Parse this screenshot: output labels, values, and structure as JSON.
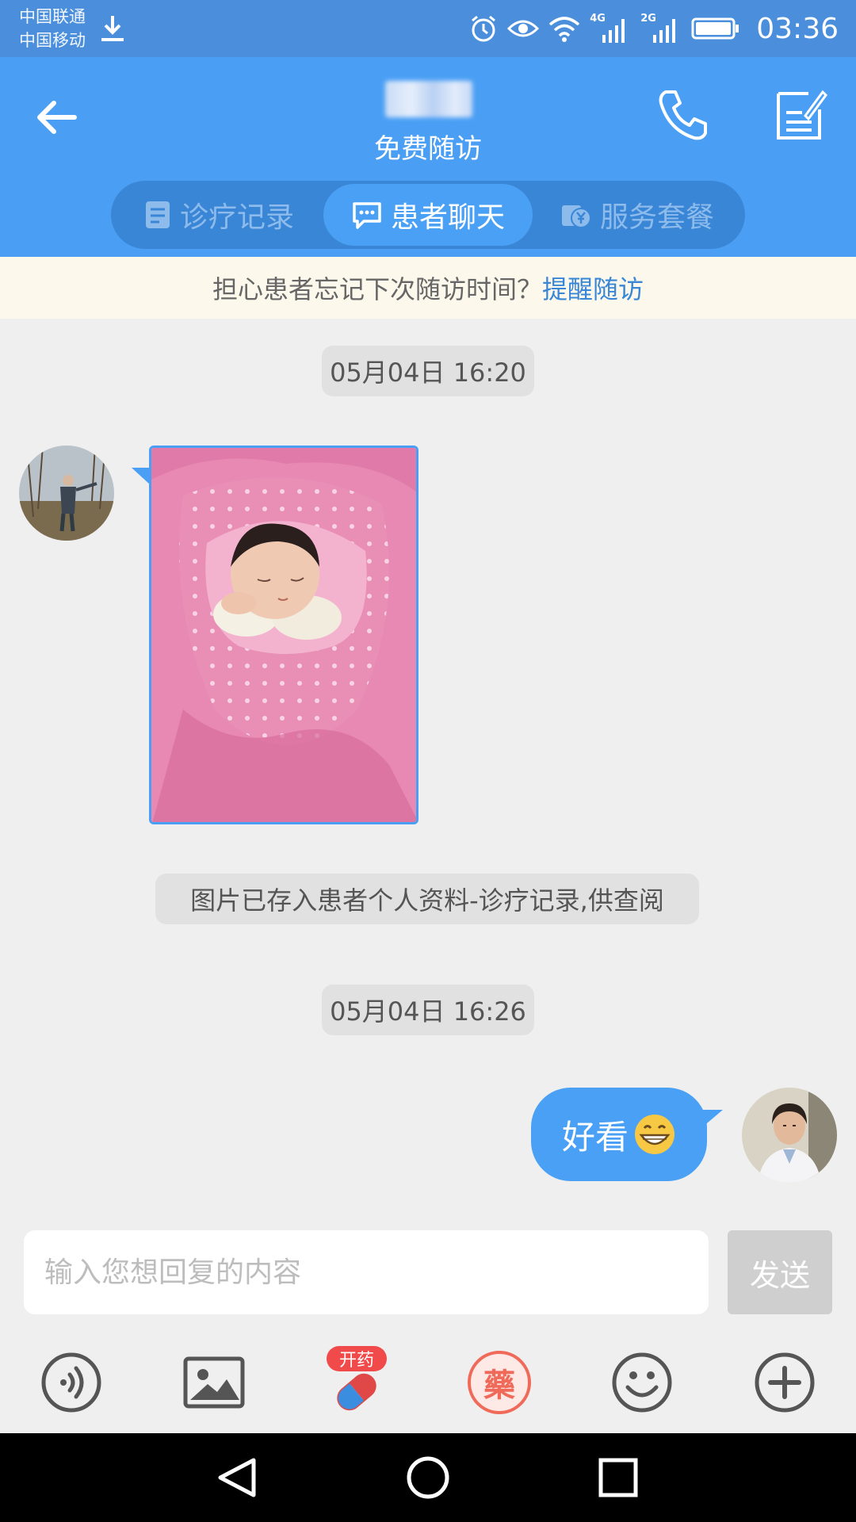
{
  "status_bar": {
    "carrier_1": "中国联通",
    "carrier_2": "中国移动",
    "net_label_1": "4G",
    "net_label_2": "2G",
    "time": "03:36"
  },
  "header": {
    "subtitle": "免费随访"
  },
  "tabs": [
    {
      "label": "诊疗记录",
      "active": false
    },
    {
      "label": "患者聊天",
      "active": true
    },
    {
      "label": "服务套餐",
      "active": false
    }
  ],
  "banner": {
    "text": "担心患者忘记下次随访时间？",
    "link": "提醒随访"
  },
  "chat": {
    "timestamp_1": "05月04日 16:20",
    "notice": "图片已存入患者个人资料-诊疗记录,供查阅",
    "timestamp_2": "05月04日 16:26",
    "reply_text": "好看",
    "reply_emoji": "grinning-face-emoji"
  },
  "input": {
    "placeholder": "输入您想回复的内容",
    "send_label": "发送"
  },
  "toolbar": {
    "prescribe_badge": "开药",
    "medicine_glyph": "藥"
  },
  "colors": {
    "header_blue": "#4a9ff5",
    "status_blue": "#4b8fdc",
    "tab_track": "#3a86d6",
    "banner_bg": "#fcf9ec",
    "link_blue": "#3a86d6",
    "send_disabled": "#cfcfcf",
    "badge_red": "#f04a4a"
  }
}
